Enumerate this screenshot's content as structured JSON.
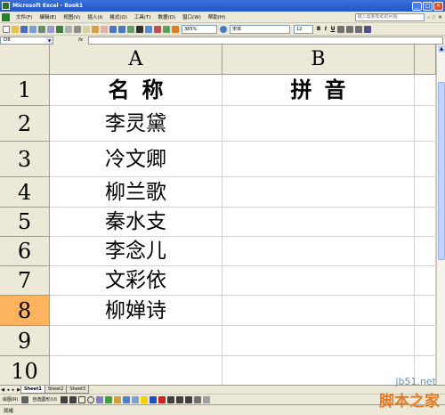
{
  "window": {
    "title": "Microsoft Excel - Book1"
  },
  "menu": {
    "items": [
      "文件(F)",
      "编辑(E)",
      "视图(V)",
      "插入(I)",
      "格式(O)",
      "工具(T)",
      "数据(D)",
      "窗口(W)",
      "帮助(H)"
    ],
    "help_placeholder": "键入需要帮助的问题",
    "close_glyph": "- ♢ ×"
  },
  "toolbar": {
    "zoom": "385%",
    "font": "宋体",
    "size": "12",
    "bold": "B",
    "italic": "I",
    "underline": "U"
  },
  "formula_bar": {
    "name_box": "D8",
    "fx": "fx"
  },
  "sheet": {
    "columns": [
      "A",
      "B"
    ],
    "rows": [
      "1",
      "2",
      "3",
      "4",
      "5",
      "6",
      "7",
      "8",
      "9",
      "10"
    ],
    "selected_row": "8",
    "header_a": "名称",
    "header_b": "拼音",
    "names": [
      "李灵黛",
      "冷文卿",
      "柳兰歌",
      "秦水支",
      "李念儿",
      "文彩依",
      "柳婵诗"
    ]
  },
  "tabs": [
    "Sheet1",
    "Sheet2",
    "Sheet3"
  ],
  "drawing": {
    "draw_label": "绘图(R)",
    "autoshapes": "自选图形(U)"
  },
  "status": {
    "text": "就绪"
  },
  "watermark": {
    "site": "jb51.net",
    "brand": "脚本之家"
  },
  "colors": {
    "selected_row": "#fbb35e",
    "title_bar": "#2456c8",
    "header_bg": "#ece9d8"
  }
}
